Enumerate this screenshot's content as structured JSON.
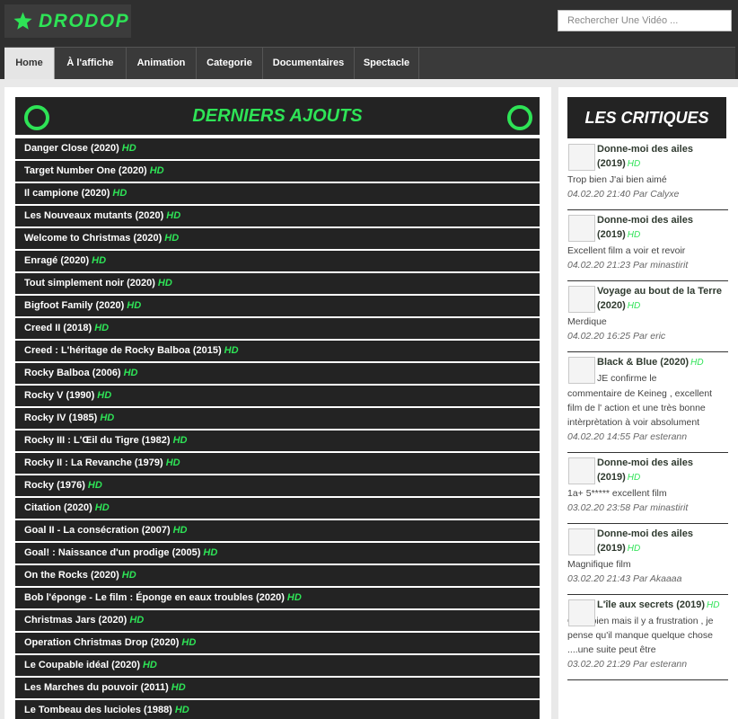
{
  "header": {
    "logo_text": "DRODOP",
    "search_placeholder": "Rechercher Une Vidéo ..."
  },
  "nav": [
    "Home",
    "À l'affiche",
    "Animation",
    "Categorie",
    "Documentaires",
    "Spectacle"
  ],
  "main": {
    "title": "DERNIERS AJOUTS",
    "hd_label": "HD",
    "movies": [
      "Danger Close (2020)",
      "Target Number One (2020)",
      "Il campione (2020)",
      "Les Nouveaux mutants (2020)",
      "Welcome to Christmas (2020)",
      "Enragé (2020)",
      "Tout simplement noir (2020)",
      "Bigfoot Family (2020)",
      "Creed II (2018)",
      "Creed : L'héritage de Rocky Balboa (2015)",
      "Rocky Balboa (2006)",
      "Rocky V (1990)",
      "Rocky IV (1985)",
      "Rocky III : L'Œil du Tigre (1982)",
      "Rocky II : La Revanche (1979)",
      "Rocky (1976)",
      "Citation (2020)",
      "Goal II - La consécration (2007)",
      "Goal! : Naissance d'un prodige (2005)",
      "On the Rocks (2020)",
      "Bob l'éponge - Le film : Éponge en eaux troubles (2020)",
      "Christmas Jars (2020)",
      "Operation Christmas Drop (2020)",
      "Le Coupable idéal (2020)",
      "Les Marches du pouvoir (2011)",
      "Le Tombeau des lucioles (1988)"
    ]
  },
  "sidebar": {
    "title": "LES CRITIQUES",
    "reviews": [
      {
        "title": "Donne-moi des ailes (2019)",
        "hd": "HD",
        "text_short": "",
        "text": "Trop bien J'ai bien aimé",
        "meta": "04.02.20 21:40 Par Calyxe"
      },
      {
        "title": "Donne-moi des ailes (2019)",
        "hd": "HD",
        "text_short": "",
        "text": "Excellent film a voir et revoir",
        "meta": "04.02.20 21:23 Par minastirit"
      },
      {
        "title": "Voyage au bout de la Terre (2020)",
        "hd": "HD",
        "text_short": "",
        "text": "Merdique",
        "meta": "04.02.20 16:25 Par eric"
      },
      {
        "title": "Black & Blue (2020)",
        "hd": "HD",
        "text_short": "JE confirme le",
        "text": "commentaire de Keineg , excellent film de l' action et une très bonne intèrprètation à voir absolument",
        "meta": "04.02.20 14:55 Par esterann"
      },
      {
        "title": "Donne-moi des ailes (2019)",
        "hd": "HD",
        "text_short": "",
        "text": "1a+ 5***** excellent film",
        "meta": "03.02.20 23:58 Par minastirit"
      },
      {
        "title": "Donne-moi des ailes (2019)",
        "hd": "HD",
        "text_short": "",
        "text": "Magnifique film",
        "meta": "03.02.20 21:43 Par Akaaaa"
      },
      {
        "title": "L'île aux secrets (2019)",
        "hd": "HD",
        "text_short": "",
        "text": "C'est bien mais il y a frustration , je pense qu'il manque quelque chose ....une suite peut être",
        "meta": "03.02.20 21:29 Par esterann"
      }
    ]
  },
  "colors": {
    "accent": "#2ee356",
    "header_bg": "#2f2f2f",
    "row_bg": "#232323"
  }
}
